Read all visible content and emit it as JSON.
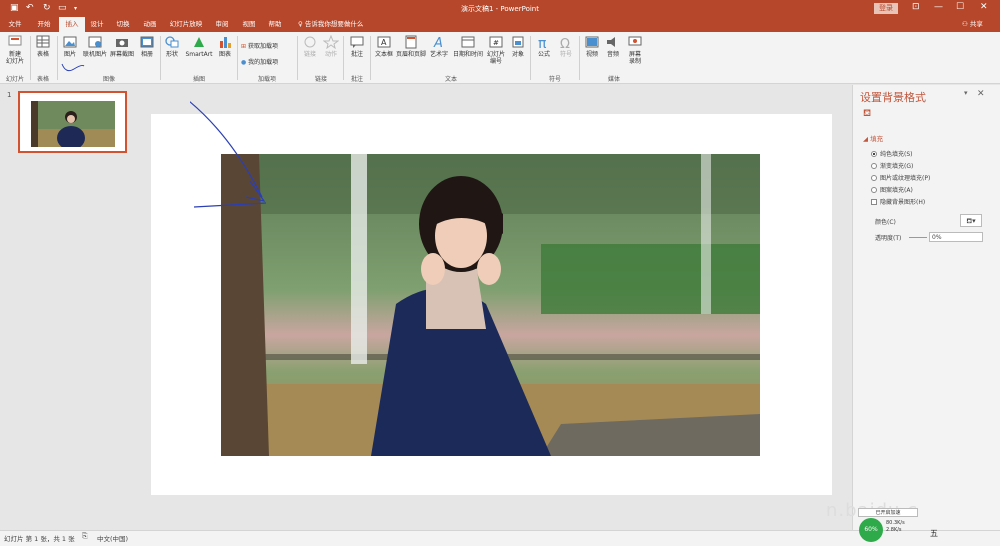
{
  "window": {
    "title": "演示文稿1 - PowerPoint",
    "login": "登录"
  },
  "tabs": [
    "文件",
    "开始",
    "插入",
    "设计",
    "切换",
    "动画",
    "幻灯片放映",
    "审阅",
    "视图",
    "帮助"
  ],
  "tell_me": "告诉我你想要做什么",
  "share": "共享",
  "ribbon": {
    "new_slide": "新建\n幻灯片",
    "table": "表格",
    "picture": "图片",
    "online_picture": "联机图片",
    "screenshot": "屏幕截图",
    "album": "相册",
    "shapes": "形状",
    "smartart": "SmartArt",
    "chart": "图表",
    "get_addins": "获取加载项",
    "my_addins": "我的加载项",
    "link": "链接",
    "action": "动作",
    "comment": "批注",
    "textbox": "文本框",
    "header_footer": "页眉和页脚",
    "wordart": "艺术字",
    "datetime": "日期和时间",
    "slide_number": "幻灯片\n编号",
    "object": "对象",
    "equation": "公式",
    "symbol": "符号",
    "video": "视频",
    "audio": "音频",
    "screen_record": "屏幕\n录制",
    "groups": {
      "slides": "幻灯片",
      "tables": "表格",
      "images": "图像",
      "illustrations": "插图",
      "addins": "加载项",
      "links": "链接",
      "comments": "批注",
      "text": "文本",
      "symbols": "符号",
      "media": "媒体"
    }
  },
  "thumbs": {
    "slide_number": "1"
  },
  "format_pane": {
    "title": "设置背景格式",
    "section": "填充",
    "options": [
      "纯色填充(S)",
      "渐变填充(G)",
      "图片或纹理填充(P)",
      "图案填充(A)"
    ],
    "selected_option": 0,
    "hide_bg": "隐藏背景图形(H)",
    "color_label": "颜色(C)",
    "transparency_label": "透明度(T)",
    "transparency_value": "0%"
  },
  "status": {
    "slide": "幻灯片 第 1 张，共 1 张",
    "language": "中文(中国)"
  },
  "overlay": {
    "watermark": "n.baidu.c",
    "net_box": "已开启加速",
    "net_percent": "60%",
    "net_up": "80.3K/s",
    "net_down": "2.8K/s",
    "ime": "五"
  },
  "colors": {
    "accent": "#b7472a",
    "pane_title": "#c2553a",
    "thumb_border": "#d35230"
  }
}
